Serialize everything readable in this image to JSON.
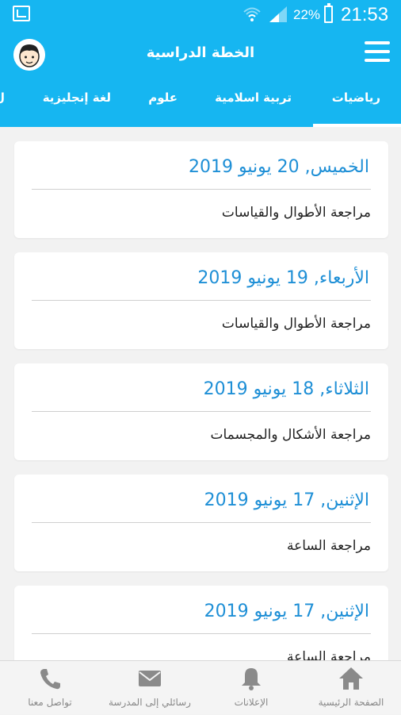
{
  "status_bar": {
    "battery_percent": "22%",
    "time": "21:53"
  },
  "app_bar": {
    "title": "الخطة الدراسية"
  },
  "tabs": [
    {
      "label": "رياضيات",
      "selected": true
    },
    {
      "label": "تربية اسلامية",
      "selected": false
    },
    {
      "label": "علوم",
      "selected": false
    },
    {
      "label": "لغة إنجليزية",
      "selected": false
    },
    {
      "label": "ل",
      "selected": false
    }
  ],
  "plan": [
    {
      "date": "الخميس, 20 يونيو 2019",
      "topic": "مراجعة الأطوال والقياسات"
    },
    {
      "date": "الأربعاء, 19 يونيو 2019",
      "topic": "مراجعة الأطوال والقياسات"
    },
    {
      "date": "الثلاثاء, 18 يونيو 2019",
      "topic": "مراجعة الأشكال والمجسمات"
    },
    {
      "date": "الإثنين, 17 يونيو 2019",
      "topic": "مراجعة الساعة"
    },
    {
      "date": "الإثنين, 17 يونيو 2019",
      "topic": "مراجعة الساعة"
    }
  ],
  "bottom_nav": [
    {
      "label": "الصفحة الرئيسية",
      "icon": "home-icon"
    },
    {
      "label": "الإعلانات",
      "icon": "bell-icon"
    },
    {
      "label": "رسائلي إلى المدرسة",
      "icon": "mail-icon"
    },
    {
      "label": "تواصل معنا",
      "icon": "phone-icon"
    }
  ],
  "colors": {
    "primary": "#16b6f1",
    "date_text": "#1e8fd6",
    "background": "#f2f2f2"
  }
}
